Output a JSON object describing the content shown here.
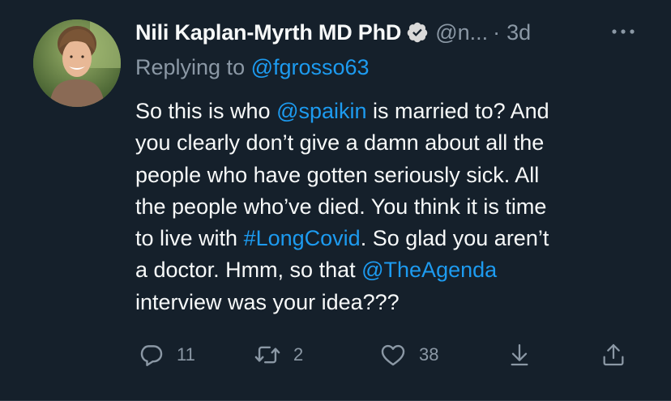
{
  "tweet": {
    "author_name": "Nili Kaplan-Myrth MD PhD",
    "author_handle": "@n...",
    "separator": "·",
    "time": "3d",
    "reply_prefix": "Replying to ",
    "reply_to": "@fgrosso63",
    "body_lines": [
      [
        {
          "t": "So this is who "
        },
        {
          "t": "@spaikin",
          "link": true
        },
        {
          "t": " is married to? And"
        }
      ],
      [
        {
          "t": "you clearly don’t give a damn about all the"
        }
      ],
      [
        {
          "t": "people who have gotten seriously sick. All"
        }
      ],
      [
        {
          "t": "the people who’ve died. You think it is time"
        }
      ],
      [
        {
          "t": "to live with "
        },
        {
          "t": "#LongCovid",
          "link": true
        },
        {
          "t": ". So glad you aren’t"
        }
      ],
      [
        {
          "t": "a doctor. Hmm, so that "
        },
        {
          "t": "@TheAgenda",
          "link": true
        }
      ],
      [
        {
          "t": "interview was your idea???"
        }
      ]
    ],
    "replies": "11",
    "retweets": "2",
    "likes": "38"
  },
  "icons": {
    "verified": "verified-badge-icon",
    "more": "more-icon",
    "reply": "reply-icon",
    "retweet": "retweet-icon",
    "like": "heart-icon",
    "download": "download-icon",
    "share": "share-icon"
  },
  "colors": {
    "background": "#15202b",
    "text": "#f7f9f9",
    "secondary": "#8b98a5",
    "link": "#1d9bf0"
  }
}
